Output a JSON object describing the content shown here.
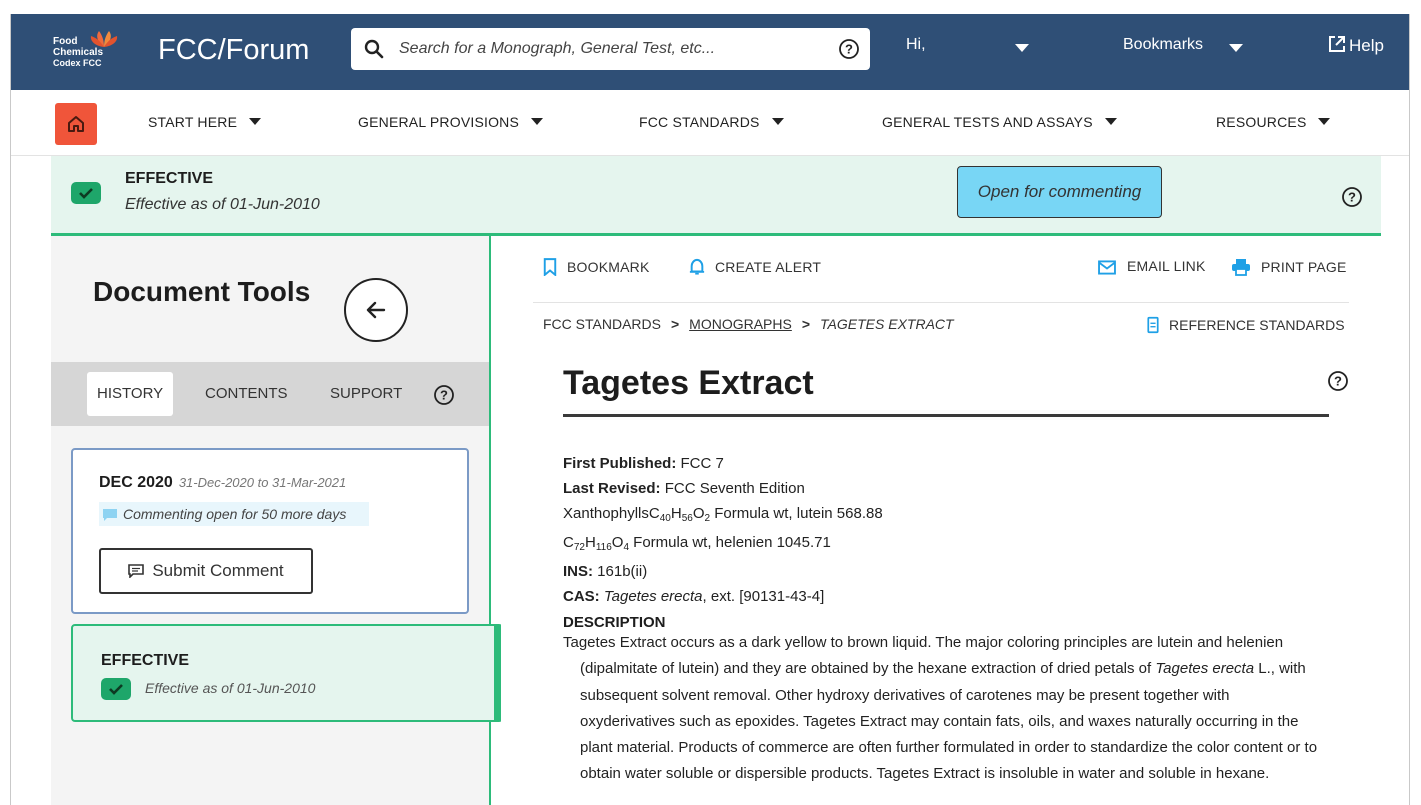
{
  "header": {
    "logo_line1": "Food",
    "logo_line2": "Chemicals",
    "logo_line3": "Codex FCC",
    "app_title": "FCC/Forum",
    "search_placeholder": "Search for a Monograph, General Test, etc...",
    "greeting": "Hi,",
    "bookmarks_label": "Bookmarks",
    "help_label": "Help"
  },
  "nav": {
    "items": [
      {
        "label": "START HERE"
      },
      {
        "label": "GENERAL PROVISIONS"
      },
      {
        "label": "FCC STANDARDS"
      },
      {
        "label": "GENERAL TESTS AND ASSAYS"
      },
      {
        "label": "RESOURCES"
      }
    ]
  },
  "status": {
    "label": "EFFECTIVE",
    "detail": "Effective as of 01-Jun-2010",
    "comment_button": "Open for commenting"
  },
  "sidebar": {
    "title": "Document Tools",
    "tabs": [
      {
        "label": "HISTORY"
      },
      {
        "label": "CONTENTS"
      },
      {
        "label": "SUPPORT"
      }
    ],
    "history": [
      {
        "title": "DEC 2020",
        "range": "31-Dec-2020 to 31-Mar-2021",
        "note": "Commenting open for 50 more days",
        "button": "Submit Comment"
      },
      {
        "title": "EFFECTIVE",
        "detail": "Effective as of 01-Jun-2010"
      }
    ]
  },
  "toolbar": {
    "bookmark": "BOOKMARK",
    "create_alert": "CREATE ALERT",
    "email_link": "EMAIL LINK",
    "print_page": "PRINT PAGE",
    "reference_standards": "REFERENCE STANDARDS"
  },
  "breadcrumb": {
    "items": [
      "FCC STANDARDS",
      "MONOGRAPHS",
      "TAGETES EXTRACT"
    ]
  },
  "monograph": {
    "title": "Tagetes Extract",
    "first_published_label": "First Published:",
    "first_published": "FCC 7",
    "last_revised_label": "Last Revised:",
    "last_revised": "FCC Seventh Edition",
    "formula1_name": "Xanthophylls",
    "formula1_tail": "Formula wt, lutein 568.88",
    "formula2_tail": "Formula wt, helenien 1045.71",
    "ins_label": "INS:",
    "ins": "161b(ii)",
    "cas_label": "CAS:",
    "cas_species": "Tagetes erecta",
    "cas_value": ", ext. [90131-43-4]",
    "description_heading": "DESCRIPTION",
    "description_part1": "Tagetes Extract occurs as a dark yellow to brown liquid. The major coloring principles are lutein and helenien (dipalmitate of lutein) and they are obtained by the hexane extraction of dried petals of ",
    "description_species": "Tagetes erecta",
    "description_part2": " L., with subsequent solvent removal. Other hydroxy derivatives of carotenes may be present together with oxyderivatives such as epoxides. Tagetes Extract may contain fats, oils, and waxes naturally occurring in the plant material. Products of commerce are often further formulated in order to standardize the color content or to obtain water soluble or dispersible products. Tagetes Extract is insoluble in water and soluble in hexane."
  },
  "colors": {
    "header_bg": "#2f4f76",
    "home_button": "#f0553a",
    "effective_green": "#2dbb7a",
    "effective_bg": "#e5f5ee",
    "comment_button": "#78d6f5",
    "icon_blue": "#1fa0e6"
  },
  "icons": {
    "search": "search-icon",
    "help": "question-circle-icon",
    "external": "external-link-icon",
    "home": "home-icon",
    "check": "check-icon",
    "back": "arrow-left-icon",
    "bookmark": "bookmark-icon",
    "alert": "bell-icon",
    "email": "envelope-icon",
    "print": "printer-icon",
    "reference": "document-icon",
    "comment": "comment-icon"
  }
}
